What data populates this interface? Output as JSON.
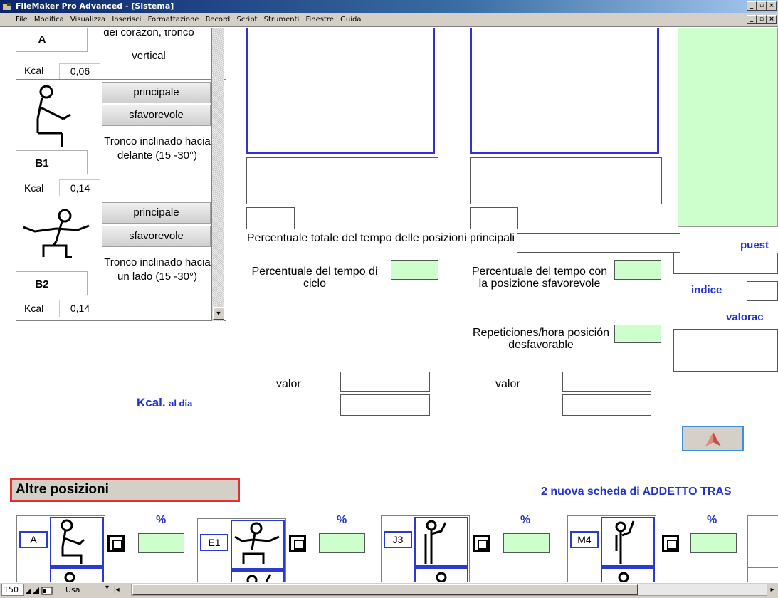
{
  "window": {
    "title": "FileMaker Pro Advanced - [Sistema]"
  },
  "menu": [
    "File",
    "Modifica",
    "Visualizza",
    "Inserisci",
    "Formattazione",
    "Record",
    "Script",
    "Strumenti",
    "Finestre",
    "Guida"
  ],
  "list": {
    "top_partial": {
      "label": "A",
      "desc_partial": "del corazon, tronco",
      "desc_line2": "vertical",
      "kcal_label": "Kcal",
      "kcal_value": "0,06"
    },
    "items": [
      {
        "label": "B1",
        "btn_principale": "principale",
        "btn_sfavorevole": "sfavorevole",
        "desc": "Tronco inclinado hacia delante  (15 -30°)",
        "kcal_label": "Kcal",
        "kcal_value": "0,14"
      },
      {
        "label": "B2",
        "btn_principale": "principale",
        "btn_sfavorevole": "sfavorevole",
        "desc": "Tronco inclinado hacia un lado  (15 -30°)",
        "kcal_label": "Kcal",
        "kcal_value": "0,14"
      }
    ]
  },
  "main": {
    "perc_totale": "Percentuale totale del tempo delle posizioni principali",
    "perc_ciclo": "Percentuale del tempo di ciclo",
    "perc_sfavorevole": "Percentuale del tempo con la posizione sfavorevole",
    "repeticiones": "Repeticiones/hora posición desfavorable",
    "valor1": "valor",
    "valor2": "valor",
    "kcal_big": "Kcal.",
    "kcal_small": "al dia",
    "puest": "puest",
    "indice": "indice",
    "valorac": "valorac"
  },
  "bottom": {
    "altre_posizioni": "Altre posizioni",
    "nuova_scheda": "2  nuova scheda di ADDETTO TRAS",
    "cards": [
      {
        "label": "A",
        "pct": "%"
      },
      {
        "label": "E1",
        "pct": "%"
      },
      {
        "label": "J3",
        "pct": "%"
      },
      {
        "label": "M4",
        "pct": "%"
      }
    ]
  },
  "status": {
    "zoom": "150",
    "mode": "Usa"
  },
  "colors": {
    "accent_blue": "#2233cc",
    "green_field": "#ccffcc",
    "red_border": "#e03030"
  }
}
